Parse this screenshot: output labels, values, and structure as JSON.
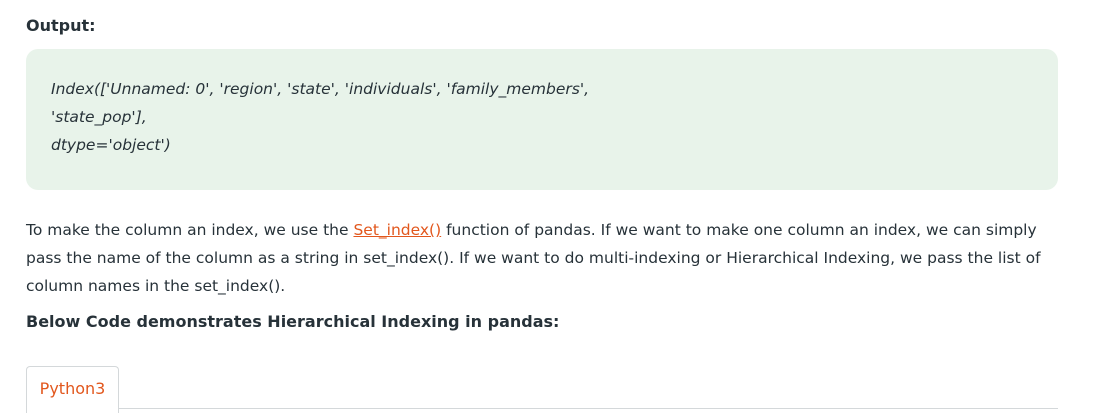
{
  "output": {
    "label": "Output:",
    "lines": [
      "Index(['Unnamed: 0', 'region', 'state', 'individuals', 'family_members',",
      "'state_pop'],",
      "dtype='object')"
    ]
  },
  "paragraph": {
    "before_link": "To make the column an index, we use the ",
    "link_text": "Set_index()",
    "after_link": " function of pandas. If we want to make one column an index, we can simply pass the name of the column as a string in set_index(). If we want to do multi-indexing or Hierarchical Indexing, we pass the list of column names in the set_index()."
  },
  "sub_heading": "Below Code demonstrates Hierarchical Indexing in pandas:",
  "code_tabs": [
    {
      "label": "Python3"
    }
  ],
  "colors": {
    "accent": "#e2571d",
    "output_bg": "#e8f3ea",
    "text": "#273239"
  }
}
